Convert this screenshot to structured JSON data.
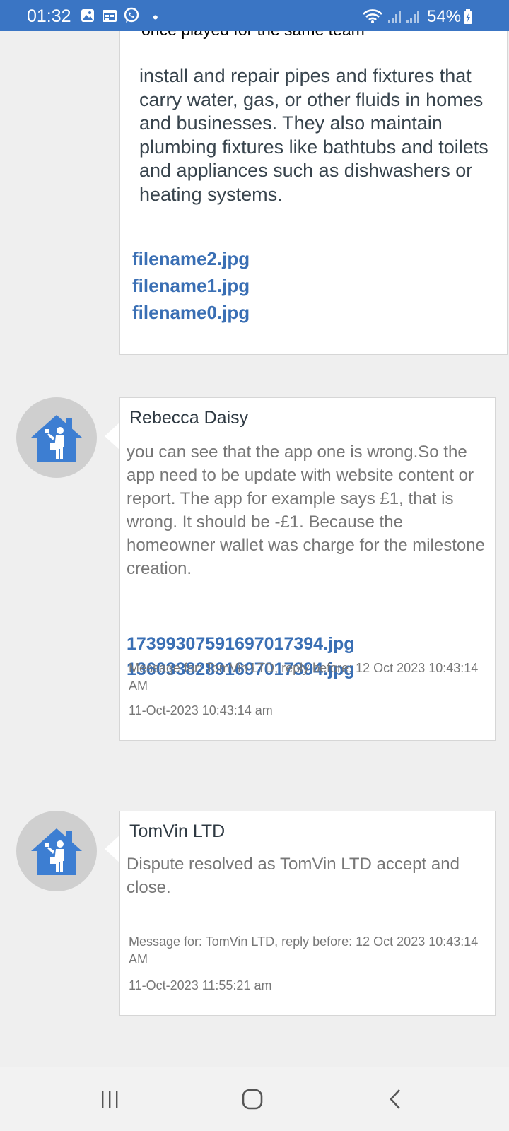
{
  "status_bar": {
    "time": "01:32",
    "battery": "54%",
    "icons": [
      "gallery-icon",
      "calendar-icon",
      "whatsapp-icon",
      "notification-dot",
      "wifi-icon",
      "signal-icon",
      "signal-icon",
      "battery-charging-icon"
    ]
  },
  "messages": [
    {
      "cut_text": "once played for the same team",
      "body": "install and repair pipes and fixtures that carry water, gas, or other fluids in homes and businesses. They also maintain plumbing fixtures like bathtubs and toilets and appliances such as dishwashers or heating systems.",
      "files": [
        "filename2.jpg",
        "filename1.jpg",
        "filename0.jpg"
      ]
    },
    {
      "sender": "Rebecca Daisy",
      "body": "you can see that the app one is wrong.So the app need to be update  with  website content or report. The app for example says £1, that is wrong. It should be -£1. Because the homeowner wallet was charge for the milestone creation.",
      "files": [
        "17399307591697017394.jpg",
        "13603382891697017394.jpg"
      ],
      "reply_info": "Message for: TomVin LTD, reply before: 12 Oct 2023 10:43:14 AM",
      "timestamp": "11-Oct-2023 10:43:14 am",
      "avatar_icon": "tradesman-house-icon"
    },
    {
      "sender": "TomVin LTD",
      "body": "Dispute resolved as  TomVin LTD accept and close.",
      "reply_info": "Message for: TomVin LTD, reply before: 12 Oct 2023 10:43:14 AM",
      "timestamp": "11-Oct-2023 11:55:21 am",
      "avatar_icon": "tradesman-house-icon"
    }
  ],
  "nav_bar": {
    "buttons": [
      "recents-icon",
      "home-icon",
      "back-icon"
    ]
  },
  "colors": {
    "status_bar": "#3a75c4",
    "link": "#3a6fb4",
    "avatar_bg": "#cfcfcf",
    "house_icon": "#3d7ed2"
  }
}
